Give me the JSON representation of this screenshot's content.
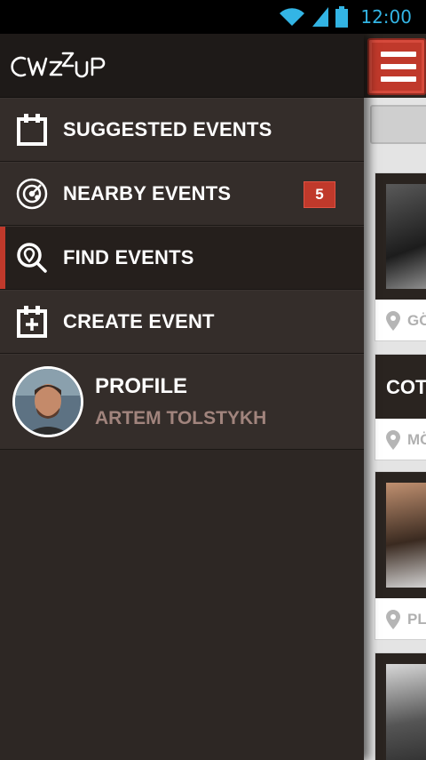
{
  "status_bar": {
    "time": "12:00"
  },
  "app": {
    "logo_text": "CWZZUP"
  },
  "menu": {
    "items": [
      {
        "label": "SUGGESTED EVENTS",
        "icon": "calendar-icon"
      },
      {
        "label": "NEARBY EVENTS",
        "icon": "radar-icon",
        "badge": "5"
      },
      {
        "label": "FIND EVENTS",
        "icon": "search-location-icon",
        "active": true
      },
      {
        "label": "CREATE EVENT",
        "icon": "calendar-add-icon"
      }
    ]
  },
  "profile": {
    "title": "PROFILE",
    "name": "ARTEM TOLSTYKH"
  },
  "background": {
    "cards": [
      {
        "location": "GÖ"
      },
      {
        "title": "COT",
        "location": "MÖ"
      },
      {
        "location": "PL"
      }
    ]
  },
  "colors": {
    "accent": "#c0392b",
    "drawer_bg": "#2d2724",
    "status_blue": "#33b5e5",
    "profile_name": "#a1847d"
  }
}
